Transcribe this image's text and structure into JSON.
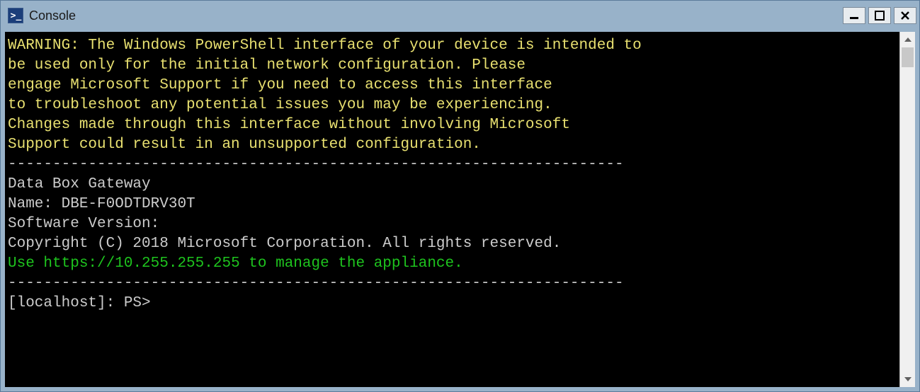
{
  "titlebar": {
    "title": "Console"
  },
  "console": {
    "warning_line1": "WARNING: The Windows PowerShell interface of your device is intended to",
    "warning_line2": "be used only for the initial network configuration. Please",
    "warning_line3": "engage Microsoft Support if you need to access this interface",
    "warning_line4": "to troubleshoot any potential issues you may be experiencing.",
    "warning_line5": "Changes made through this interface without involving Microsoft",
    "warning_line6": "Support could result in an unsupported configuration.",
    "separator": "---------------------------------------------------------------------",
    "product": "Data Box Gateway",
    "name": "Name: DBE-F0ODTDRV30T",
    "software_version": "Software Version:",
    "copyright": "Copyright (C) 2018 Microsoft Corporation. All rights reserved.",
    "manage_prefix": "Use ",
    "manage_url": "https://10.255.255.255 ",
    "manage_suffix": "to manage the appliance.",
    "prompt": "[localhost]: PS>"
  }
}
